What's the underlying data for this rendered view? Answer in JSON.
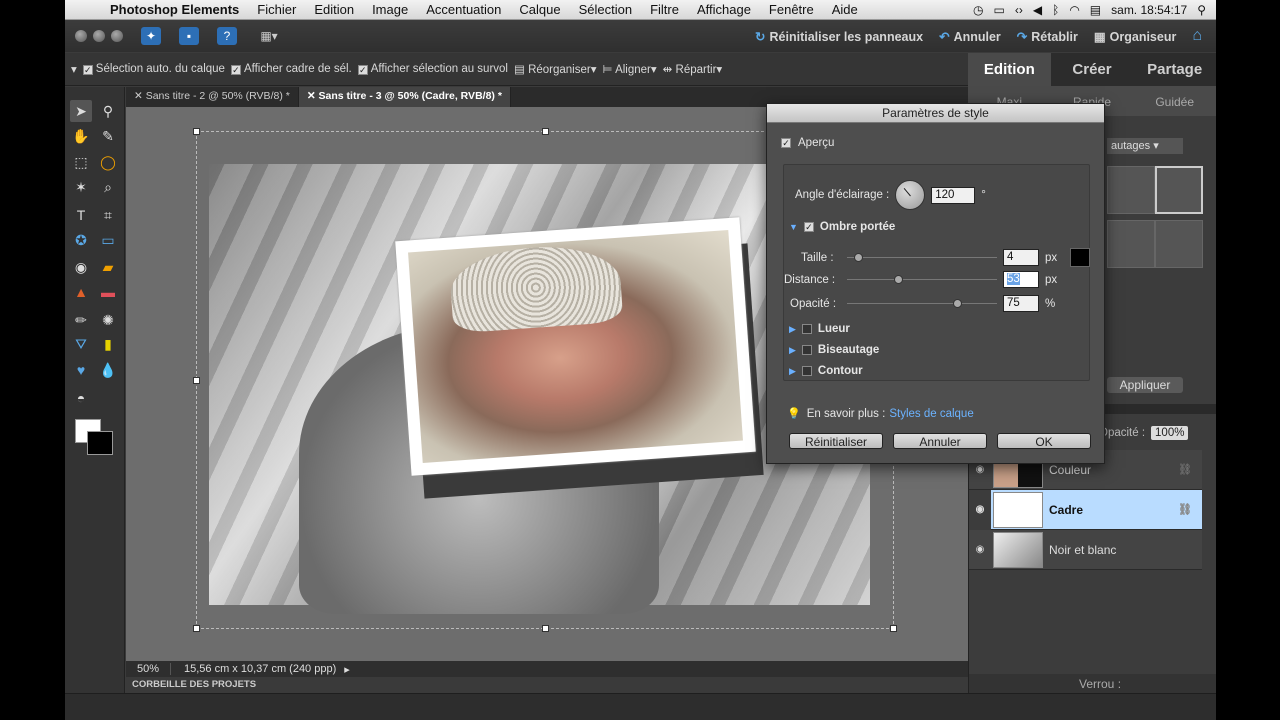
{
  "menubar": {
    "app_name": "Photoshop Elements",
    "items": [
      "Fichier",
      "Edition",
      "Image",
      "Accentuation",
      "Calque",
      "Sélection",
      "Filtre",
      "Affichage",
      "Fenêtre",
      "Aide"
    ],
    "clock": "sam. 18:54:17"
  },
  "toprow": {
    "reset_panels": "Réinitialiser les panneaux",
    "undo": "Annuler",
    "redo": "Rétablir",
    "organizer": "Organiseur"
  },
  "options": {
    "auto_select": "Sélection auto. du calque",
    "show_bbox": "Afficher cadre de sél.",
    "show_hover": "Afficher sélection au survol",
    "arrange": "Réorganiser",
    "align": "Aligner",
    "distribute": "Répartir"
  },
  "rtabs": [
    "Edition",
    "Créer",
    "Partage"
  ],
  "rsubtabs": [
    "Maxi",
    "Rapide",
    "Guidée"
  ],
  "doctabs": [
    "Sans titre - 2 @ 50% (RVB/8) *",
    "Sans titre - 3 @ 50% (Cadre, RVB/8) *"
  ],
  "status": {
    "zoom": "50%",
    "dimensions": "15,56 cm x 10,37 cm (240 ppp)",
    "project_bin": "CORBEILLE DES PROJETS"
  },
  "panel": {
    "effects_dropdown": "autages",
    "apply": "Appliquer",
    "opacity_label": "Opacité :",
    "opacity_value": "100%",
    "layers": [
      {
        "name": "Couleur"
      },
      {
        "name": "Cadre"
      },
      {
        "name": "Noir et blanc"
      }
    ],
    "lock_label": "Verrou :"
  },
  "dialog": {
    "title": "Paramètres de style",
    "preview": "Aperçu",
    "angle_label": "Angle d'éclairage :",
    "angle_value": "120",
    "angle_unit": "°",
    "drop_shadow": "Ombre portée",
    "size_label": "Taille :",
    "size_value": "4",
    "distance_label": "Distance :",
    "distance_value": "53",
    "opacity_label": "Opacité :",
    "opacity_value": "75",
    "px": "px",
    "percent": "%",
    "glow": "Lueur",
    "bevel": "Biseautage",
    "stroke": "Contour",
    "learn_more": "En savoir plus :",
    "learn_link": "Styles de calque",
    "reset": "Réinitialiser",
    "cancel": "Annuler",
    "ok": "OK",
    "size_fraction": 0.05,
    "distance_fraction": 0.33,
    "opacity_fraction": 0.75,
    "shadow_color": "#000000"
  }
}
